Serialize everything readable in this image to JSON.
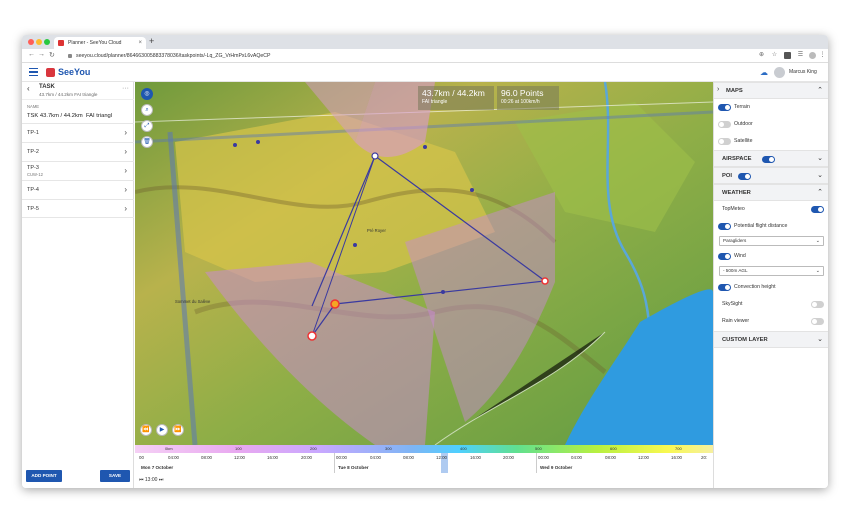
{
  "browser": {
    "tab_title": "Planner - SeeYou Cloud",
    "tab_close": "×",
    "new_tab": "+",
    "url": "seeyou.cloud/planner/8646630058833780​36/taskpoints/-Lq_ZG_VrHmPxL6vAQeCP"
  },
  "app": {
    "logo": "SeeYou",
    "user_name": "Marcus King"
  },
  "task": {
    "back_icon": "‹",
    "title": "TASK",
    "subtitle": "43.7km / 44.2km FAI triangle",
    "more": "···",
    "name_label": "NAME",
    "name_value": "TSK 43.7km / 44.2km  FAI triangl",
    "points": [
      {
        "name": "TP-1",
        "note": ""
      },
      {
        "name": "TP-2",
        "note": ""
      },
      {
        "name": "TP-3",
        "note": "CUW-12"
      },
      {
        "name": "TP-4",
        "note": ""
      },
      {
        "name": "TP-5",
        "note": ""
      }
    ],
    "add_point": "ADD POINT",
    "save": "SAVE"
  },
  "map": {
    "distance": "43.7km / 44.2km",
    "task_type": "FAI triangle",
    "points": "96.0 Points",
    "time_speed": "00:26 at 100km/h",
    "places": [
      "Pré Royer",
      "Sommet du Salève"
    ]
  },
  "timeline": {
    "scale_labels": [
      "0km",
      "100",
      "200",
      "300",
      "400",
      "500",
      "600",
      "700"
    ],
    "hours": [
      "00",
      "04:00",
      "08:00",
      "12:00",
      "16:00",
      "20:00",
      "00:00",
      "04:00",
      "08:00",
      "12:00",
      "16:00",
      "20:00",
      "00:00",
      "04:00",
      "08:00",
      "12:00",
      "16:00",
      "20:"
    ],
    "days": [
      "Mon 7 October",
      "Tue 8 October",
      "Wed 9 October"
    ],
    "player_time": "13:00"
  },
  "panel": {
    "maps_label": "MAPS",
    "terrain": "Terrain",
    "outdoor": "Outdoor",
    "satellite": "Satellite",
    "airspace": "AIRSPACE",
    "poi": "POI",
    "weather": "WEATHER",
    "topmeteo": "TopMeteo",
    "potential_flight": "Potential flight distance",
    "paragliders": "Paragliders",
    "wind": "Wind",
    "wind_level": "- 500m AGL",
    "convection": "Convection height",
    "skysight": "SkySight",
    "rain_viewer": "Rain viewer",
    "custom_layer": "CUSTOM LAYER"
  }
}
